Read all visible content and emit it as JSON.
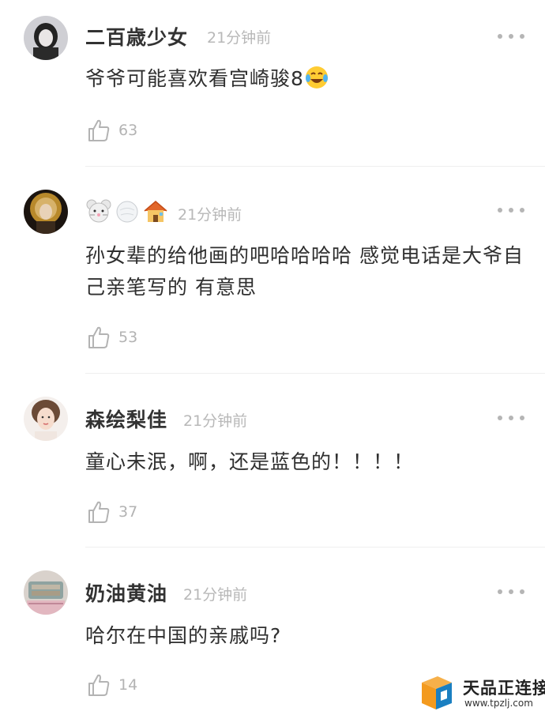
{
  "comments": [
    {
      "name": "二百歳少女",
      "time": "21分钟前",
      "text": "爷爷可能喜欢看宫崎骏8",
      "likes": "63",
      "text_emoji": "laughing-tears-emoji"
    },
    {
      "name": "",
      "time": "21分钟前",
      "name_emojis": [
        "mouse-face-emoji",
        "snowball-emoji",
        "house-emoji"
      ],
      "text": "孙女辈的给他画的吧哈哈哈哈 感觉电话是大爷自己亲笔写的 有意思",
      "likes": "53"
    },
    {
      "name": "森绘梨佳",
      "time": "21分钟前",
      "text": "童心未泯，啊，还是蓝色的！！！！",
      "likes": "37"
    },
    {
      "name": "奶油黄油",
      "time": "21分钟前",
      "text": "哈尔在中国的亲戚吗?",
      "likes": "14"
    }
  ],
  "watermark": {
    "title": "天品正连接",
    "url": "www.tpzlj.com"
  },
  "colors": {
    "name": "#333333",
    "meta": "#b8b8b8",
    "text": "#2f2f2f",
    "divider": "#eeeeee",
    "logo_orange": "#f39a1e",
    "logo_blue": "#1a7fc1"
  }
}
